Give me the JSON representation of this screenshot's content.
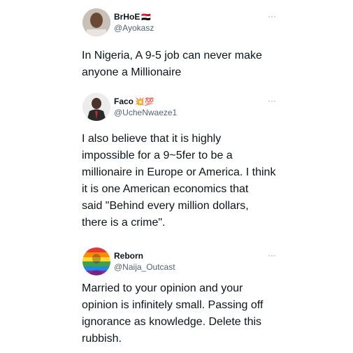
{
  "tweets": [
    {
      "name": "BrHoE",
      "name_emoji": "🇪🇬",
      "handle": "@Ayokasz",
      "more": "···",
      "text": "In Nigeria,  A 9-5 job can never make\nanyone a Millionaire"
    },
    {
      "name": "Faco",
      "name_emoji": "💥💯",
      "handle": "@UcheNwaeze1",
      "more": "···",
      "text": "I also believe that it is highly\nimpossible for a 9~5fer to be  a\nmillionaire in Europe or America. I think\nit is one American economics that\nsaid \"Behind every million dollars,\nthere is a crime\"."
    },
    {
      "name": "Reborn",
      "name_emoji": "",
      "handle": "@Naija_Outcast",
      "more": "···",
      "text": "Married to your opinion and your\nopinion is infinitely small. Passing off\nignorance as knowledge. Delete this\nrubbish."
    }
  ]
}
